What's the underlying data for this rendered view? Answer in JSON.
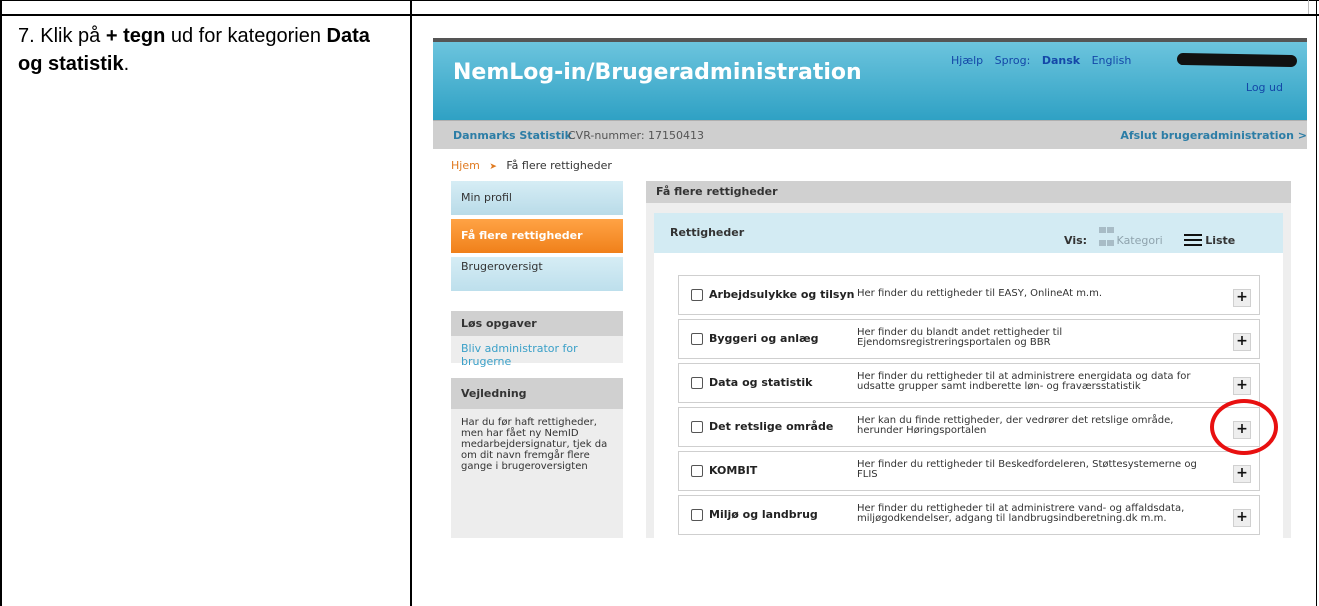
{
  "instruction": {
    "step": "7. Klik på",
    "plus_symbol": "+",
    "action": "tegn",
    "rest": "ud for kategorien",
    "category": "Data og statistik",
    "end": "."
  },
  "header": {
    "brand": "NemLog-in/Brugeradministration",
    "help": "Hjælp",
    "language_label": "Sprog:",
    "lang_active": "Dansk",
    "lang_other": "English",
    "logout": "Log ud"
  },
  "orgbar": {
    "org_name": "Danmarks Statistik",
    "cvr": "CVR-nummer: 17150413",
    "exit": "Afslut brugeradministration >"
  },
  "breadcrumb": {
    "home": "Hjem",
    "current": "Få flere rettigheder"
  },
  "sidebar": {
    "items": [
      {
        "label": "Min profil"
      },
      {
        "label": "Få flere rettigheder"
      },
      {
        "label": "Brugeroversigt"
      }
    ],
    "tasks_title": "Løs opgaver",
    "tasks_link": "Bliv administrator for brugerne",
    "guide_title": "Vejledning",
    "guide_text": "Har du før haft rettigheder, men har fået ny NemID medarbejdersignatur, tjek da om dit navn fremgår flere gange i brugeroversigten"
  },
  "main": {
    "title": "Få flere rettigheder",
    "inner_title": "Rettigheder",
    "vis_label": "Vis:",
    "view_category": "Kategori",
    "view_list": "Liste",
    "rows": [
      {
        "name": "Arbejdsulykke og tilsyn",
        "desc": "Her finder du rettigheder til EASY, OnlineAt m.m.",
        "plus": "+"
      },
      {
        "name": "Byggeri og anlæg",
        "desc": "Her finder du blandt andet rettigheder til Ejendomsregistreringsportalen og BBR",
        "plus": "+"
      },
      {
        "name": "Data og statistik",
        "desc": "Her finder du rettigheder til at administrere energidata og data for udsatte grupper samt indberette løn- og fraværsstatistik",
        "plus": "+"
      },
      {
        "name": "Det retslige område",
        "desc": "Her kan du finde rettigheder, der vedrører det retslige område, herunder Høringsportalen",
        "plus": "+"
      },
      {
        "name": "KOMBIT",
        "desc": "Her finder du rettigheder til Beskedfordeleren, Støttesystemerne og FLIS",
        "plus": "+"
      },
      {
        "name": "Miljø og landbrug",
        "desc": "Her finder du rettigheder til at administrere vand- og affaldsdata, miljøgodkendelser, adgang til landbrugsindberetning.dk m.m.",
        "plus": "+"
      }
    ]
  },
  "colors": {
    "header_blue": "#2fa1c4",
    "active_orange": "#f0801a",
    "highlight_red": "#e81010"
  }
}
